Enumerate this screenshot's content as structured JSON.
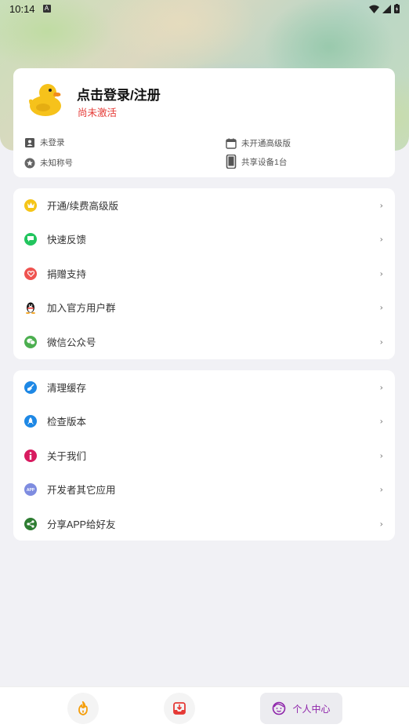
{
  "status_bar": {
    "time": "10:14",
    "a_badge": "A"
  },
  "profile": {
    "avatar_icon": "rubber-duck-icon",
    "login_title": "点击登录/注册",
    "activate_status": "尚未激活",
    "activate_color": "#e53935",
    "info": {
      "login_state": "未登录",
      "premium_state": "未开通高级版",
      "nickname": "未知称号",
      "shared_devices": "共享设备1台"
    }
  },
  "menu_group_1": [
    {
      "label": "开通/续费高级版",
      "icon": "crown-icon",
      "color": "#f5c518"
    },
    {
      "label": "快速反馈",
      "icon": "chat-icon",
      "color": "#22c55e"
    },
    {
      "label": "捐赠支持",
      "icon": "heart-icon",
      "color": "#ef5350"
    },
    {
      "label": "加入官方用户群",
      "icon": "qq-penguin-icon",
      "color": "#111111"
    },
    {
      "label": "微信公众号",
      "icon": "wechat-icon",
      "color": "#4caf50"
    }
  ],
  "menu_group_2": [
    {
      "label": "清理缓存",
      "icon": "broom-icon",
      "color": "#1e88e5"
    },
    {
      "label": "检查版本",
      "icon": "rocket-icon",
      "color": "#1e88e5"
    },
    {
      "label": "关于我们",
      "icon": "info-icon",
      "color": "#d81b60"
    },
    {
      "label": "开发者其它应用",
      "icon": "app-icon",
      "color": "#7e8ce0"
    },
    {
      "label": "分享APP给好友",
      "icon": "share-icon",
      "color": "#2e7d32"
    }
  ],
  "chevron": "›",
  "bottom_nav": {
    "home_icon": "flame-icon",
    "inbox_icon": "inbox-icon",
    "profile_icon": "smiley-face-icon",
    "profile_label": "个人中心",
    "active_color": "#8e24aa"
  }
}
